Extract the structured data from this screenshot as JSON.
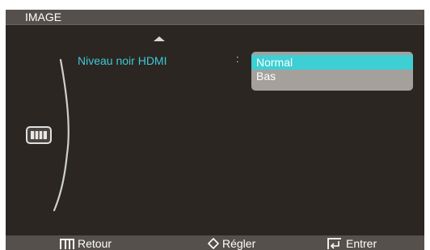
{
  "menu": {
    "title": "IMAGE"
  },
  "setting": {
    "label": "Niveau noir HDMI",
    "separator": ":",
    "options": [
      "Normal",
      "Bas"
    ],
    "selected": "Normal"
  },
  "footer": {
    "back_label": "Retour",
    "adjust_label": "Régler",
    "enter_label": "Entrer"
  },
  "colors": {
    "highlight": "#3dcfd4",
    "label": "#3ec9d6",
    "panel": "#2b2622",
    "bar": "#55504b",
    "dropdown": "#a4a19d"
  },
  "icons": {
    "side_category": "picture-category-icon",
    "scroll": "triangle-up-icon",
    "back": "menu-icon",
    "adjust": "up-down-icon",
    "enter": "enter-icon"
  }
}
